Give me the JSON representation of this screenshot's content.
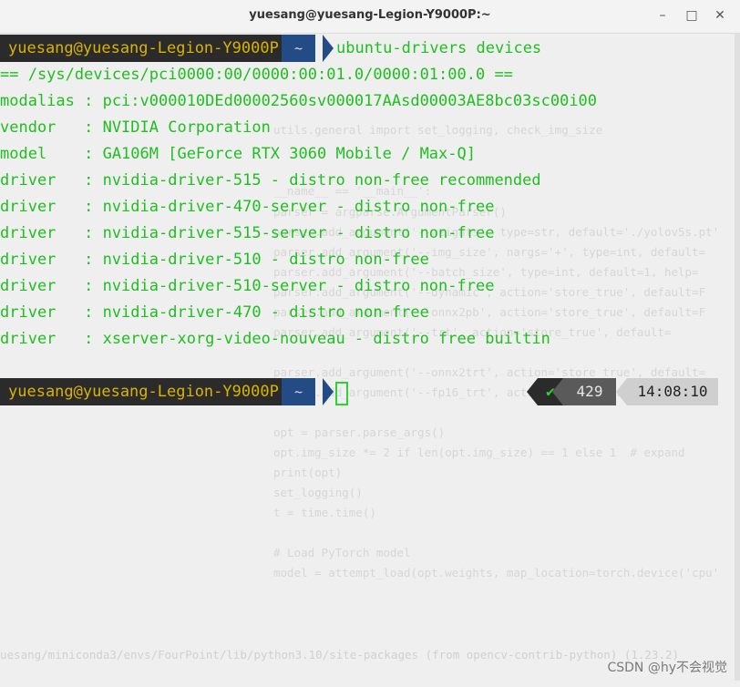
{
  "window": {
    "title": "yuesang@yuesang-Legion-Y9000P:~",
    "minimize_glyph": "–",
    "maximize_glyph": "□",
    "close_glyph": "✕"
  },
  "prompt1": {
    "user_host": "yuesang@yuesang-Legion-Y9000P",
    "dir": "~",
    "command": "ubuntu-drivers devices"
  },
  "output": [
    "== /sys/devices/pci0000:00/0000:00:01.0/0000:01:00.0 ==",
    "modalias : pci:v000010DEd00002560sv000017AAsd00003AE8bc03sc00i00",
    "vendor   : NVIDIA Corporation",
    "model    : GA106M [GeForce RTX 3060 Mobile / Max-Q]",
    "driver   : nvidia-driver-515 - distro non-free recommended",
    "driver   : nvidia-driver-470-server - distro non-free",
    "driver   : nvidia-driver-515-server - distro non-free",
    "driver   : nvidia-driver-510 - distro non-free",
    "driver   : nvidia-driver-510-server - distro non-free",
    "driver   : nvidia-driver-470 - distro non-free",
    "driver   : xserver-xorg-video-nouveau - distro free builtin"
  ],
  "prompt2": {
    "user_host": "yuesang@yuesang-Legion-Y9000P",
    "dir": "~",
    "status_check": "✔",
    "history_number": "429",
    "time": "14:08:10"
  },
  "background_code": [
    "utils.general import set_logging, check_img_size",
    "__name__ == '__main__':",
    "parser = argparse.ArgumentParser()",
    "parser.add_argument('--weights', type=str, default='./yolov5s.pt'",
    "parser.add_argument('--img_size', nargs='+', type=int, default=",
    "parser.add_argument('--batch_size', type=int, default=1, help=",
    "parser.add_argument('--dynamic', action='store_true', default=F",
    "parser.add_argument('--onnx2pb', action='store_true', default=F",
    "parser.add_argument('--trt', action='store_true', default=",
    "parser.add_argument('--onnx2trt', action='store_true', default=",
    "parser.add_argument('--fp16_trt', action='store_true', default=",
    "opt = parser.parse_args()",
    "opt.img_size *= 2 if len(opt.img_size) == 1 else 1  # expand",
    "print(opt)",
    "set_logging()",
    "t = time.time()",
    "# Load PyTorch model",
    "model = attempt_load(opt.weights, map_location=torch.device('cpu'"
  ],
  "background_path": "uesang/miniconda3/envs/FourPoint/lib/python3.10/site-packages (from opencv-contrib-python) (1.23.2)",
  "watermark": "CSDN @hy不会视觉",
  "colors": {
    "terminal_bg": "#efefef",
    "output_green": "#1fbf1f",
    "prompt_user_bg": "#2b2b2b",
    "prompt_user_fg": "#d9b300",
    "prompt_dir_bg": "#234b86"
  }
}
